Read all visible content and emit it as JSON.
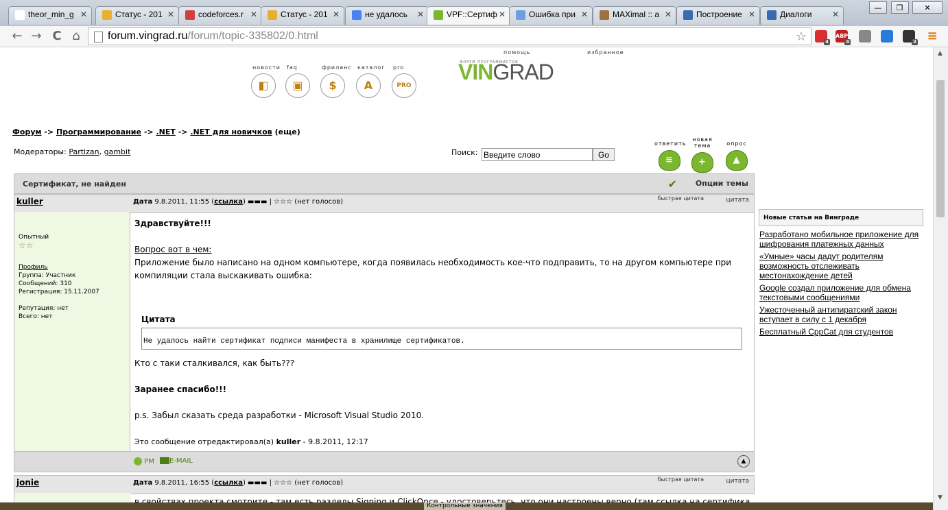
{
  "browser": {
    "tabs": [
      {
        "label": "theor_min_g",
        "color": "#ffffff"
      },
      {
        "label": "Статус - 201",
        "color": "#e8b030"
      },
      {
        "label": "codeforces.r",
        "color": "#d04040"
      },
      {
        "label": "Статус - 201",
        "color": "#e8b030"
      },
      {
        "label": "не удалось",
        "color": "#4a80f0"
      },
      {
        "label": "VPF::Сертиф",
        "color": "#7cb82f"
      },
      {
        "label": "Ошибка при",
        "color": "#6aa0e0"
      },
      {
        "label": "MAXimal :: a",
        "color": "#a07040"
      },
      {
        "label": "Построение",
        "color": "#3a6ab0"
      },
      {
        "label": "Диалоги",
        "color": "#3a6ab0"
      }
    ],
    "close_glyph": "✕",
    "url_host": "forum.vingrad.ru",
    "url_path": "/forum/topic-335802/0.html",
    "back_glyph": "←",
    "forward_glyph": "→",
    "reload_glyph": "C",
    "home_glyph": "⌂",
    "star_glyph": "☆",
    "menu_glyph": "≡",
    "win_min": "—",
    "win_max": "❐",
    "win_close": "✕",
    "extensions": [
      {
        "icon": "stop-icon",
        "badge": "4",
        "color": "#d83030"
      },
      {
        "icon": "adblock-icon",
        "text": "ABP",
        "badge": "4",
        "color": "#c02020"
      },
      {
        "icon": "quote-icon",
        "color": "#888888"
      },
      {
        "icon": "cloud-icon",
        "color": "#2a7ad8"
      },
      {
        "icon": "notify-icon",
        "badge": "2",
        "color": "#333333"
      }
    ]
  },
  "site": {
    "logo_sub": "ФОРУМ ПРОГРАММИСТОВ",
    "logo_vin": "VIN",
    "logo_grad": "GRAD",
    "nav": [
      {
        "label": "новости",
        "glyph": "◧"
      },
      {
        "label": "faq",
        "glyph": "▣"
      },
      {
        "label": "фриланс",
        "glyph": "$"
      },
      {
        "label": "каталог",
        "glyph": "A"
      },
      {
        "label": "pro",
        "glyph": "PRO"
      }
    ],
    "top_labels": [
      "помощь",
      "избранное"
    ]
  },
  "breadcrumb": {
    "items": [
      "Форум",
      "Программирование",
      ".NET",
      ".NET для новичков"
    ],
    "sep": "->",
    "more": "(еще)"
  },
  "moderators": {
    "label": "Модераторы:",
    "names": [
      "Partizan",
      "gambit"
    ]
  },
  "search": {
    "label": "Поиск:",
    "value": "Введите слово",
    "button": "Go"
  },
  "actions": [
    {
      "label": "ответить",
      "glyph": "≡"
    },
    {
      "label": "новая тема",
      "glyph": "+"
    },
    {
      "label": "опрос",
      "glyph": "▲"
    }
  ],
  "topic": {
    "title": "Сертификат, не найден",
    "options": "Опции темы",
    "check_glyph": "✔"
  },
  "posts": [
    {
      "author": "kuller",
      "date_label": "Дата",
      "date": "9.8.2011, 11:55",
      "link_label": "ссылка",
      "votes": "(нет голосов)",
      "quick_quote": "быстрая цитата",
      "quote": "цитата",
      "rank": "Опытный",
      "rank_stars": "☆☆",
      "profile": "Профиль",
      "group": "Группа: Участник",
      "messages": "Сообщений: 310",
      "registration": "Регистрация: 15.11.2007",
      "reputation": "Репутация: нет",
      "total": "Всего: нет",
      "greeting": "Здравствуйте!!!",
      "question": "Вопрос вот в чем:",
      "text1": "Приложение было написано на одном компьютере, когда появилась необходимость кое-что подправить, то на другом компьютере при компиляции стала выскакивать ошибка:",
      "quote_title": "Цитата",
      "quote_text": "Не удалось найти сертификат подписи манифеста в хранилище сертификатов.",
      "text2": "Кто с таки сталкивался, как быть???",
      "thanks": "Заранее спасибо!!!",
      "ps": "p.s. Забыл сказать среда разработки - Microsoft Visual Studio 2010.",
      "edited_prefix": "Это сообщение отредактировал(а)",
      "edited_by": "kuller",
      "edited_date": "- 9.8.2011, 12:17",
      "pm": "PM",
      "email": "E-MAIL",
      "up_glyph": "▲"
    },
    {
      "author": "jonie",
      "date_label": "Дата",
      "date": "9.8.2011, 16:55",
      "link_label": "ссылка",
      "votes": "(нет голосов)",
      "quick_quote": "быстрая цитата",
      "quote": "цитата",
      "snippet": "в свойствах проекта смотрите - там есть разделы Signing и ClickOnce - удостоверьтесь, что они настроены верно (там ссылка на сертификат как"
    }
  ],
  "sidebar": {
    "title": "Новые статьи на Винграде",
    "links": [
      "Разработано мобильное приложение для шифрования платежных данных",
      "«Умные» часы дадут родителям возможность отслеживать местонахождение детей",
      "Google создал приложение для обмена текстовыми сообщениями",
      "Ужесточенный антипиратский закон вступает в силу с 1 декабря",
      "Бесплатный CppCat для студентов"
    ]
  },
  "taskbar": {
    "item": "Контрольные значения"
  }
}
